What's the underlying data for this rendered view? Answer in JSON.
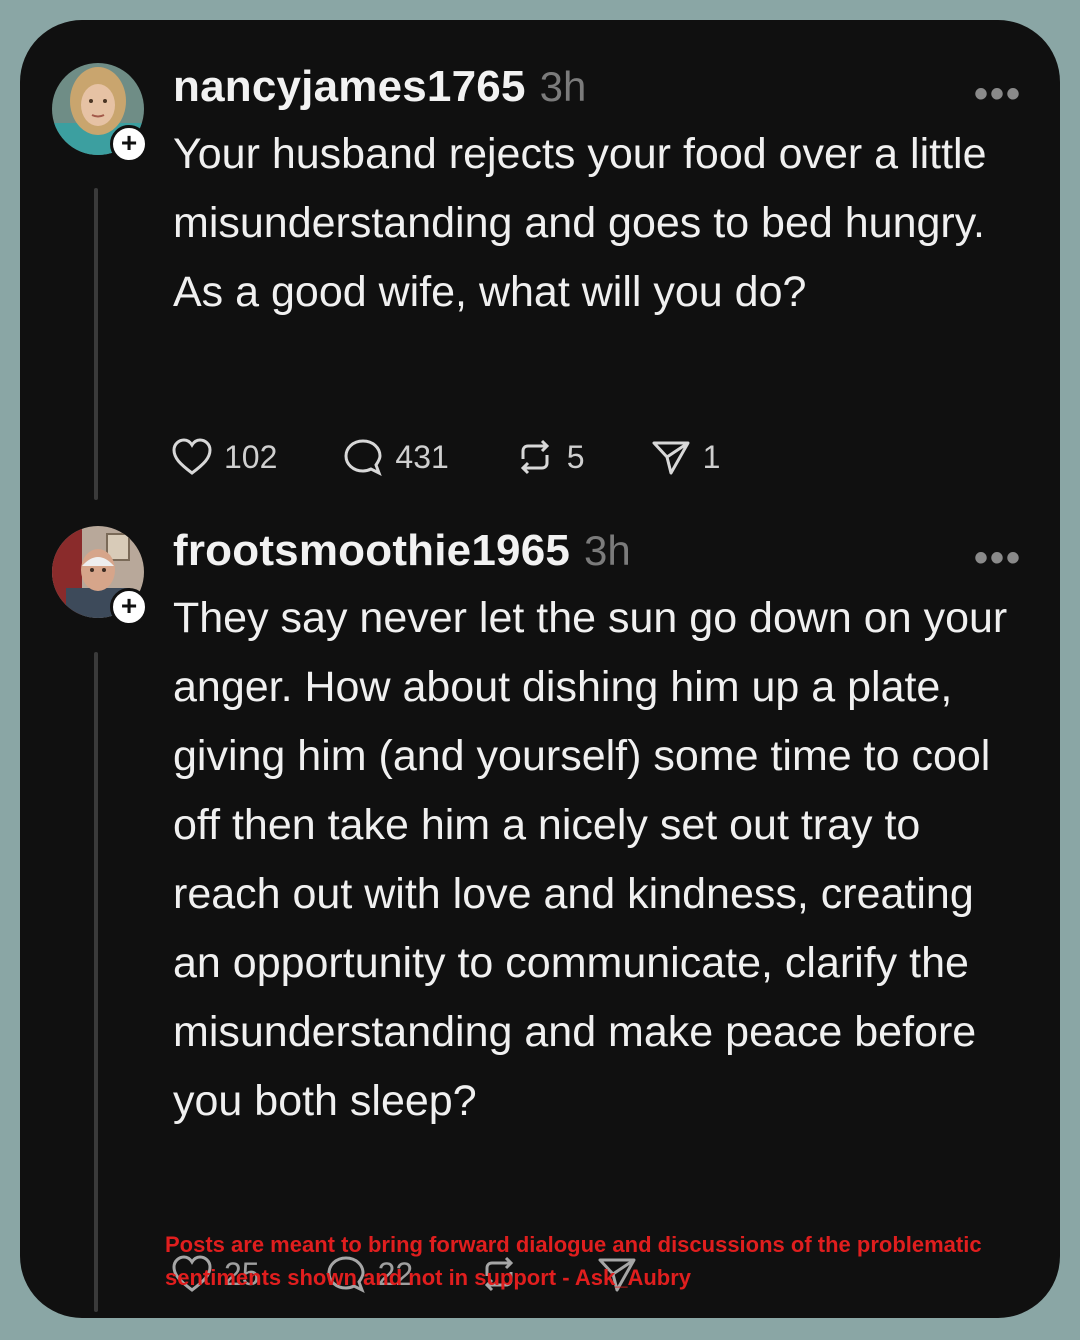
{
  "posts": [
    {
      "username": "nancyjames1765",
      "time": "3h",
      "text": "Your husband rejects your food over a little misunderstanding and goes to bed hungry. As a good wife, what will you do?",
      "likes": "102",
      "replies": "431",
      "reposts": "5",
      "shares": "1"
    },
    {
      "username": "frootsmoothie1965",
      "time": "3h",
      "text": "They say never let the sun go down on your anger. How about dishing him up a plate, giving him (and yourself) some time to cool off then take him a nicely set out tray to reach out with love and kindness, creating an opportunity to communicate, clarify the misunderstanding and make peace before you both sleep?",
      "likes": "25",
      "replies": "22"
    }
  ],
  "more_label": "•••",
  "follow_label": "+",
  "watermark": "Posts are meant to bring forward dialogue and discussions of the problematic sentiments shown and not in support - Ask_Aubry",
  "colors": {
    "background": "#8aa6a5",
    "card": "#101010",
    "text": "#f0f0f0",
    "muted": "#7b7b7b",
    "watermark": "#e01e1e"
  },
  "icons": [
    "heart-icon",
    "comment-icon",
    "repost-icon",
    "send-icon",
    "more-icon",
    "plus-icon"
  ]
}
